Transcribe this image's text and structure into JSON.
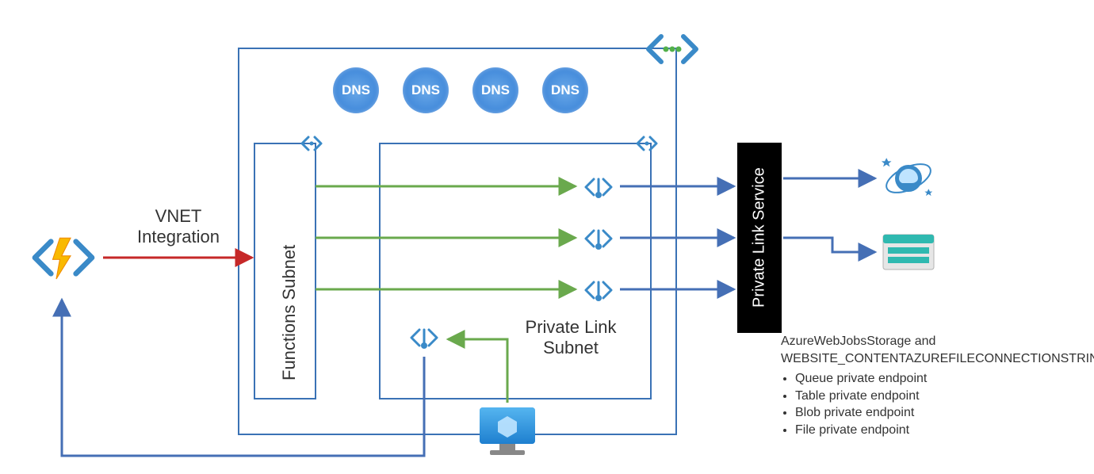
{
  "labels": {
    "vnet_integration": "VNET Integration",
    "functions_subnet": "Functions Subnet",
    "private_link_subnet": "Private Link Subnet",
    "private_link_service": "Private Link Service"
  },
  "dns_icons": [
    "DNS",
    "DNS",
    "DNS",
    "DNS"
  ],
  "notes": {
    "heading": "AzureWebJobsStorage and WEBSITE_CONTENTAZUREFILECONNECTIONSTRING",
    "items": [
      "Queue private endpoint",
      "Table private endpoint",
      "Blob private endpoint",
      "File private endpoint"
    ]
  },
  "icons": {
    "function_app": "azure-function-app",
    "virtual_machine": "azure-vm",
    "cosmos_db": "azure-cosmos-db",
    "storage_account": "azure-storage-account",
    "private_endpoint": "private-endpoint-code-icon",
    "vnet_code": "vnet-code-icon",
    "ellipsis_code": "ellipsis-code-icon"
  },
  "colors": {
    "border_blue": "#3a72b5",
    "arrow_blue": "#456fb5",
    "arrow_green": "#6aa94d",
    "arrow_red": "#c62828"
  }
}
